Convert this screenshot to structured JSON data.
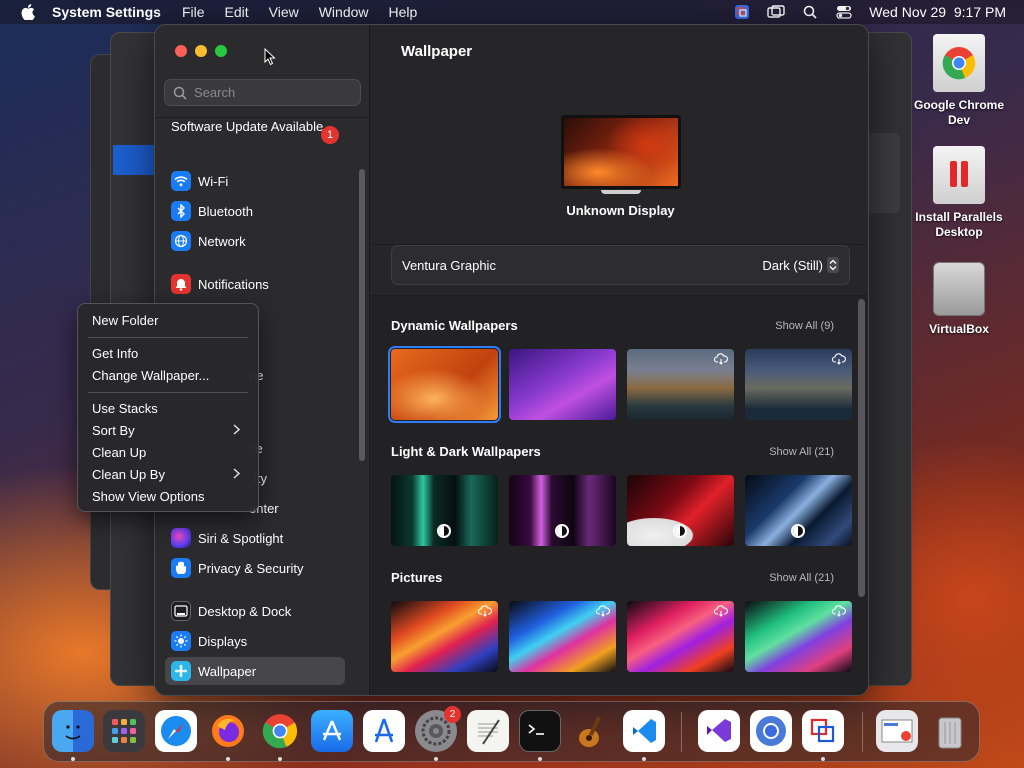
{
  "menubar": {
    "app_name": "System Settings",
    "menus": [
      "File",
      "Edit",
      "View",
      "Window",
      "Help"
    ],
    "datetime": "Wed Nov 29  9:17 PM"
  },
  "sidebar": {
    "search_placeholder": "Search",
    "update_text": "Software Update Available",
    "update_badge": "1",
    "items": [
      {
        "label": "Wi-Fi",
        "icon": "wifi-icon",
        "color": "#1a7cf5"
      },
      {
        "label": "Bluetooth",
        "icon": "bluetooth-icon",
        "color": "#1a7cf5"
      },
      {
        "label": "Network",
        "icon": "globe-icon",
        "color": "#1a7cf5"
      },
      {
        "label": "Notifications",
        "icon": "bell-icon",
        "color": "#e5342f"
      },
      {
        "label": "ne",
        "icon": "",
        "color": ""
      },
      {
        "label": "ce",
        "icon": "",
        "color": ""
      },
      {
        "label": "ity",
        "icon": "",
        "color": ""
      },
      {
        "label": "enter",
        "icon": "",
        "color": ""
      },
      {
        "label": "Siri & Spotlight",
        "icon": "siri-icon",
        "color": "#8a3df0"
      },
      {
        "label": "Privacy & Security",
        "icon": "hand-icon",
        "color": "#1a7cf5"
      },
      {
        "label": "Desktop & Dock",
        "icon": "dock-icon",
        "color": "#222"
      },
      {
        "label": "Displays",
        "icon": "sun-icon",
        "color": "#1a7cf5"
      },
      {
        "label": "Wallpaper",
        "icon": "wallpaper-icon",
        "color": "#2fb6e8"
      }
    ]
  },
  "content": {
    "title": "Wallpaper",
    "display_name": "Unknown Display",
    "wallpaper_name": "Ventura Graphic",
    "wallpaper_mode": "Dark (Still)",
    "sections": [
      {
        "title": "Dynamic Wallpapers",
        "show_all": "Show All (9)"
      },
      {
        "title": "Light & Dark Wallpapers",
        "show_all": "Show All (21)"
      },
      {
        "title": "Pictures",
        "show_all": "Show All (21)"
      }
    ]
  },
  "context_menu": {
    "items": [
      "New Folder",
      "Get Info",
      "Change Wallpaper...",
      "Use Stacks",
      "Sort By",
      "Clean Up",
      "Clean Up By",
      "Show View Options"
    ]
  },
  "desktop_icons": [
    {
      "label": "Google Chrome Dev"
    },
    {
      "label": "Install Parallels Desktop"
    },
    {
      "label": "VirtualBox"
    }
  ],
  "dock": {
    "settings_badge": "2"
  }
}
